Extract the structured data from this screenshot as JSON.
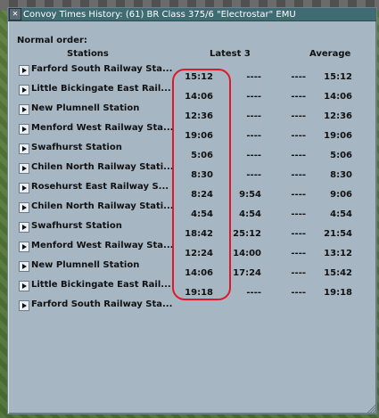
{
  "window": {
    "title": "Convoy Times History: (61) BR Class 375/6 \"Electrostar\" EMU",
    "close_glyph": "✕"
  },
  "section_label": "Normal order:",
  "headers": {
    "stations": "Stations",
    "latest": "Latest 3",
    "average": "Average"
  },
  "rows": [
    {
      "station": "Farford South Railway Sta...",
      "t1": "15:12",
      "t2": "----",
      "t3": "----",
      "avg": "15:12"
    },
    {
      "station": "Little Bickingate East Rail...",
      "t1": "14:06",
      "t2": "----",
      "t3": "----",
      "avg": "14:06"
    },
    {
      "station": "New Plumnell Station",
      "t1": "12:36",
      "t2": "----",
      "t3": "----",
      "avg": "12:36"
    },
    {
      "station": "Menford West Railway Sta...",
      "t1": "19:06",
      "t2": "----",
      "t3": "----",
      "avg": "19:06"
    },
    {
      "station": "Swafhurst Station",
      "t1": "5:06",
      "t2": "----",
      "t3": "----",
      "avg": "5:06"
    },
    {
      "station": "Chilen North Railway Stati...",
      "t1": "8:30",
      "t2": "----",
      "t3": "----",
      "avg": "8:30"
    },
    {
      "station": "Rosehurst East Railway S...",
      "t1": "8:24",
      "t2": "9:54",
      "t3": "----",
      "avg": "9:06"
    },
    {
      "station": "Chilen North Railway Stati...",
      "t1": "4:54",
      "t2": "4:54",
      "t3": "----",
      "avg": "4:54"
    },
    {
      "station": "Swafhurst Station",
      "t1": "18:42",
      "t2": "25:12",
      "t3": "----",
      "avg": "21:54"
    },
    {
      "station": "Menford West Railway Sta...",
      "t1": "12:24",
      "t2": "14:00",
      "t3": "----",
      "avg": "13:12"
    },
    {
      "station": "New Plumnell Station",
      "t1": "14:06",
      "t2": "17:24",
      "t3": "----",
      "avg": "15:42"
    },
    {
      "station": "Little Bickingate East Rail...",
      "t1": "19:18",
      "t2": "----",
      "t3": "----",
      "avg": "19:18"
    },
    {
      "station": "Farford South Railway Sta...",
      "t1": "",
      "t2": "",
      "t3": "",
      "avg": ""
    }
  ],
  "colors": {
    "window_bg": "#a7b6c3",
    "titlebar_bg": "#3f6b73",
    "highlight_stroke": "#e0162b"
  }
}
